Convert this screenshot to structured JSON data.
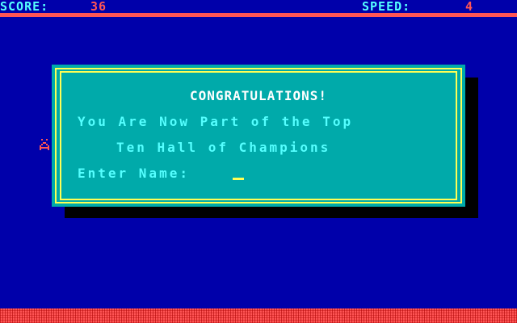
{
  "status": {
    "score_label": "SCORE:",
    "score_value": "36",
    "speed_label": "SPEED:",
    "speed_value": "4"
  },
  "dialog": {
    "title": "CONGRATULATIONS!",
    "message_line1": "You Are Now Part of the Top",
    "message_line2": "Ten Hall of Champions",
    "name_label": "Enter Name:",
    "name_value": ""
  },
  "colors": {
    "background": "#0000AA",
    "dialog_bg": "#00AAAA",
    "frame": "#FFFF55",
    "accent_red": "#FF5555",
    "label_cyan": "#55FFFF",
    "title_white": "#FFFFFF",
    "shadow": "#000000"
  }
}
